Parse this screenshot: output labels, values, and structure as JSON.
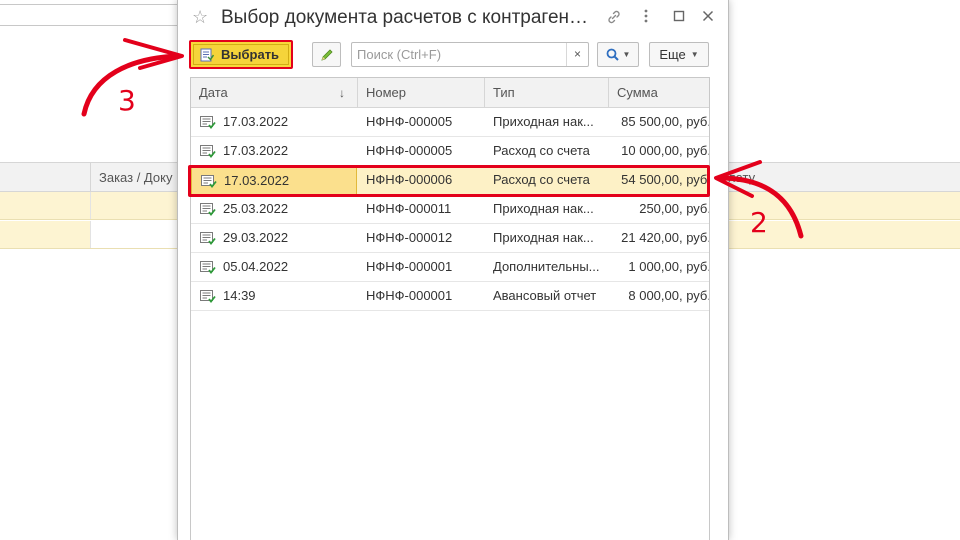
{
  "background": {
    "column_order": "Заказ / Доку",
    "column_pay": "лату"
  },
  "dialog": {
    "title": "Выбор документа расчетов с контраген…",
    "toolbar": {
      "select_label": "Выбрать",
      "search_placeholder": "Поиск (Ctrl+F)",
      "search_clear": "×",
      "more_label": "Еще"
    },
    "table": {
      "headers": {
        "date": "Дата",
        "number": "Номер",
        "type": "Тип",
        "sum": "Сумма",
        "sort_indicator": "↓"
      },
      "rows": [
        {
          "date": "17.03.2022",
          "number": "НФНФ-000005",
          "type": "Приходная нак...",
          "sum": "85 500,00, руб."
        },
        {
          "date": "17.03.2022",
          "number": "НФНФ-000005",
          "type": "Расход со счета",
          "sum": "10 000,00, руб."
        },
        {
          "date": "17.03.2022",
          "number": "НФНФ-000006",
          "type": "Расход со счета",
          "sum": "54 500,00, руб."
        },
        {
          "date": "25.03.2022",
          "number": "НФНФ-000011",
          "type": "Приходная нак...",
          "sum": "250,00, руб."
        },
        {
          "date": "29.03.2022",
          "number": "НФНФ-000012",
          "type": "Приходная нак...",
          "sum": "21 420,00, руб."
        },
        {
          "date": "05.04.2022",
          "number": "НФНФ-000001",
          "type": "Дополнительны...",
          "sum": "1 000,00, руб."
        },
        {
          "date": "14:39",
          "number": "НФНФ-000001",
          "type": "Авансовый отчет",
          "sum": "8 000,00, руб."
        }
      ]
    }
  },
  "annotations": {
    "step_select": "3",
    "step_row": "2"
  },
  "colors": {
    "accent_red": "#e3001b",
    "select_button_yellow": "#f5d43a",
    "selected_row": "#fdf1c6"
  }
}
